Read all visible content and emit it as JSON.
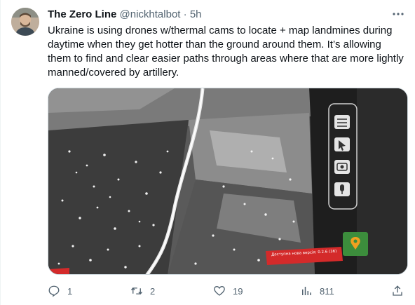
{
  "tweet": {
    "display_name": "The Zero Line",
    "handle": "@nickhtalbot",
    "separator": "·",
    "time": "5h",
    "text": "Ukraine is using drones w/thermal cams to locate + map landmines during daytime when they get hotter than the ground around them. It’s allowing them to find and clear easier paths through areas where that are more lightly manned/covered by artillery.",
    "media": {
      "overlay_banner": "Доступна нова версія: 0.2.6 (36)",
      "icons": [
        "layers-icon",
        "cursor-icon",
        "camera-icon",
        "microphone-icon",
        "map-pin-icon"
      ]
    }
  },
  "actions": {
    "reply_count": "1",
    "retweet_count": "2",
    "like_count": "19",
    "views_count": "811"
  },
  "colors": {
    "text": "#0f1419",
    "secondary": "#536471",
    "border": "#cfd9de",
    "banner_red": "#d42a2a"
  }
}
